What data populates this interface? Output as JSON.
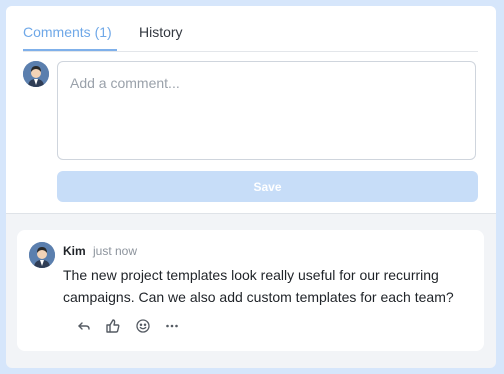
{
  "tabs": [
    {
      "label": "Comments (1)",
      "active": true
    },
    {
      "label": "History",
      "active": false
    }
  ],
  "composer": {
    "placeholder": "Add a comment...",
    "save_label": "Save"
  },
  "comments": [
    {
      "author": "Kim",
      "time": "just now",
      "text": "The new project templates look really useful for our recurring campaigns. Can we also add custom templates for each team?",
      "actions": [
        "reply-icon",
        "thumbs-up-icon",
        "emoji-icon",
        "more-icon"
      ]
    }
  ],
  "colors": {
    "accent": "#6fa8e8",
    "save_button": "#c7ddf8",
    "background": "#d6e6fb"
  }
}
